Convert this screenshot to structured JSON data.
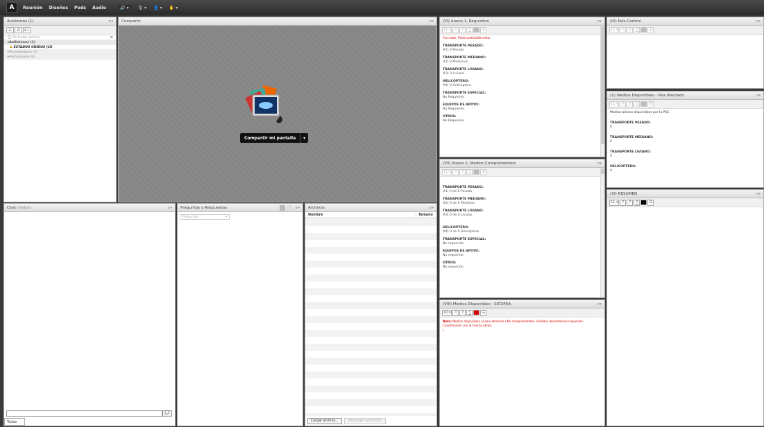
{
  "menu": [
    "Reunión",
    "Diseños",
    "Pods",
    "Audio"
  ],
  "toolbar": {
    "mic_arrow": "▾",
    "cam_arrow": "▾",
    "user_arrow": "▾",
    "hand_arrow": "▾"
  },
  "attendees": {
    "title": "Asistentes",
    "count": "(1)",
    "active_speakers": "Parlantes activos",
    "hosts": "Anfitriones (1)",
    "host_name": "ESTADOS UNIDOS JCR",
    "presenters": "Presentadores (0)",
    "participants": "Participantes (0)"
  },
  "share": {
    "title": "Compartir",
    "button": "Compartir mi pantalla"
  },
  "chat": {
    "title": "Chat",
    "scope": "(Todos)",
    "tab": "Todos"
  },
  "qa": {
    "title": "Preguntas y Respuestas",
    "filter": "Preguntas"
  },
  "files": {
    "title": "Archivos",
    "col_name": "Nombre",
    "col_size": "Tamaño",
    "upload": "Cargar archivo...",
    "download": "Descargar archivo(s)"
  },
  "anexo1": {
    "title": "(VI) Anexo 1, Requisitos",
    "format": "Formato: País/cantidad/medio",
    "items": [
      {
        "label": "TRANSPORTE PESADO:",
        "value": "#1) 0 Pesado"
      },
      {
        "label": "TRANSPORTE MEDIANO:",
        "value": "#2) 0 Medianos"
      },
      {
        "label": "TRANSPORTE LIVIANO:",
        "value": "#3) 0 Liviano"
      },
      {
        "label": "HELICÓPTERO:",
        "value": "#4) 0 Helicóptero"
      },
      {
        "label": "TRANSPORTE ESPECIAL:",
        "value": "No Requerido"
      },
      {
        "label": "EQUIPOS DE APOYO:",
        "value": "No Requerido"
      },
      {
        "label": "OTROS:",
        "value": "No Requerido"
      }
    ]
  },
  "anexo2": {
    "title": "(VII) Anexo 2, Medios Comprometidos",
    "items": [
      {
        "label": "TRANSPORTE PESADO:",
        "value": "#1) 0 de 0 Pesado"
      },
      {
        "label": "TRANSPORTE MEDIANO:",
        "value": "#2) 0 de 0 Mediano"
      },
      {
        "label": "TRANSPORTE LIVIANO:",
        "value": "#3) 0 de 0 Liviano"
      },
      {
        "label": "HELICÓPTERO:",
        "value": "#4) 0 de 0 Helicóptero"
      },
      {
        "label": "TRANSPORTE ESPECIAL:",
        "value": "No requerido"
      },
      {
        "label": "EQUIPOS DE APOYO:",
        "value": "No requerido"
      },
      {
        "label": "OTROS:",
        "value": "No requerido"
      }
    ]
  },
  "sicofaa": {
    "title": "(VIII) Medios Disponibles - SICOFAA",
    "font_size": "10",
    "note_label": "Nota:",
    "note": "Medios disponibles al país afectado / No comprometidos. Posibles diplomáticos requerida / Coordinación con la Fuerza aérea."
  },
  "pais_control": {
    "title": "(IX) País Control",
    "font_size": "11"
  },
  "medios_afectado": {
    "title": "(X) Medios Disponibles - País Afectado",
    "intro": "Medios aéreos disponibles por la PAE.",
    "items": [
      {
        "label": "TRANSPORTE PESADO:",
        "value": "0"
      },
      {
        "label": "TRANSPORTE MEDIANO:",
        "value": "0"
      },
      {
        "label": "TRANSPORTE LIVIANO:",
        "value": "0"
      },
      {
        "label": "HELICÓPTERO:",
        "value": "0"
      }
    ]
  },
  "resumen": {
    "title": "(XI) RESUMEN",
    "font_size": "11"
  },
  "colors": {
    "accent_red": "#dd0000",
    "speaker_green": "#3c3"
  }
}
